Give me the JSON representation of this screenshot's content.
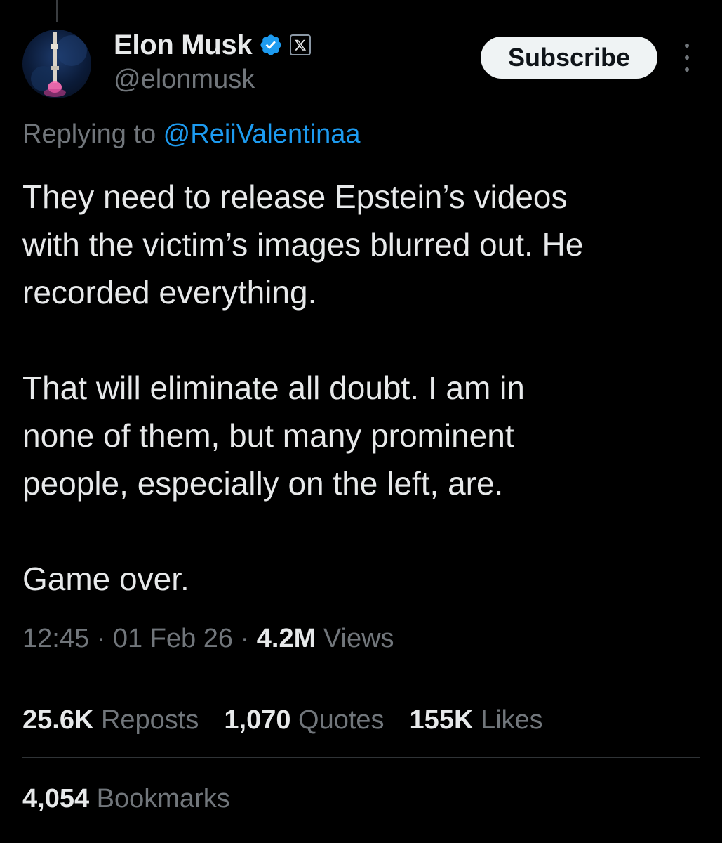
{
  "author": {
    "display_name": "Elon Musk",
    "handle": "@elonmusk",
    "avatar_icon": "rocket-avatar",
    "verified_icon": "verified-badge-icon",
    "affiliate_icon": "x-logo-icon"
  },
  "header": {
    "subscribe_label": "Subscribe",
    "more_icon": "more-vertical-icon"
  },
  "reply": {
    "prefix": "Replying to ",
    "mention": "@ReiiValentinaa"
  },
  "tweet": {
    "paragraphs": [
      "They need to release Epstein’s videos\nwith the victim’s images blurred out. He\nrecorded everything.",
      "That will eliminate all doubt. I am in\nnone of them, but many prominent\npeople, especially on the left, are.",
      "Game over."
    ]
  },
  "meta": {
    "time": "12:45",
    "sep1": " · ",
    "date": "01 Feb 26",
    "sep2": " · ",
    "views_count": "4.2M",
    "views_label": " Views"
  },
  "stats": {
    "reposts_count": "25.6K",
    "reposts_label": " Reposts",
    "quotes_count": "1,070",
    "quotes_label": " Quotes",
    "likes_count": "155K",
    "likes_label": " Likes",
    "bookmarks_count": "4,054",
    "bookmarks_label": " Bookmarks"
  },
  "colors": {
    "background": "#000000",
    "text_primary": "#e7e9ea",
    "text_secondary": "#71767b",
    "link_blue": "#1d9bf0",
    "verified_blue": "#1d9bf0",
    "divider": "#2f3336",
    "button_bg": "#eff3f4"
  }
}
